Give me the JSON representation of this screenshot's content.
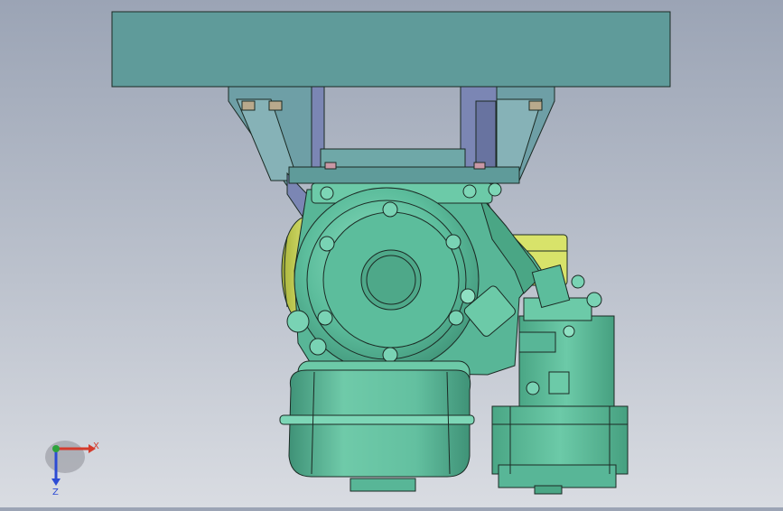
{
  "viewport": {
    "background_top": "#9ba4b5",
    "background_bottom": "#d9dce2"
  },
  "colors": {
    "plate": "#5f9b9a",
    "bracket": "#6e9fa6",
    "bracket_dark": "#7b86b4",
    "housing": "#58b697",
    "housing_light": "#79d3b4",
    "housing_dark": "#3f9277",
    "yellow": "#d8e36a",
    "outline": "#1b2a24",
    "axis_x": "#d43b2c",
    "axis_y": "#2da33b",
    "axis_z": "#2c4bd4"
  },
  "triad": {
    "x_label": "X",
    "z_label": "Z"
  }
}
